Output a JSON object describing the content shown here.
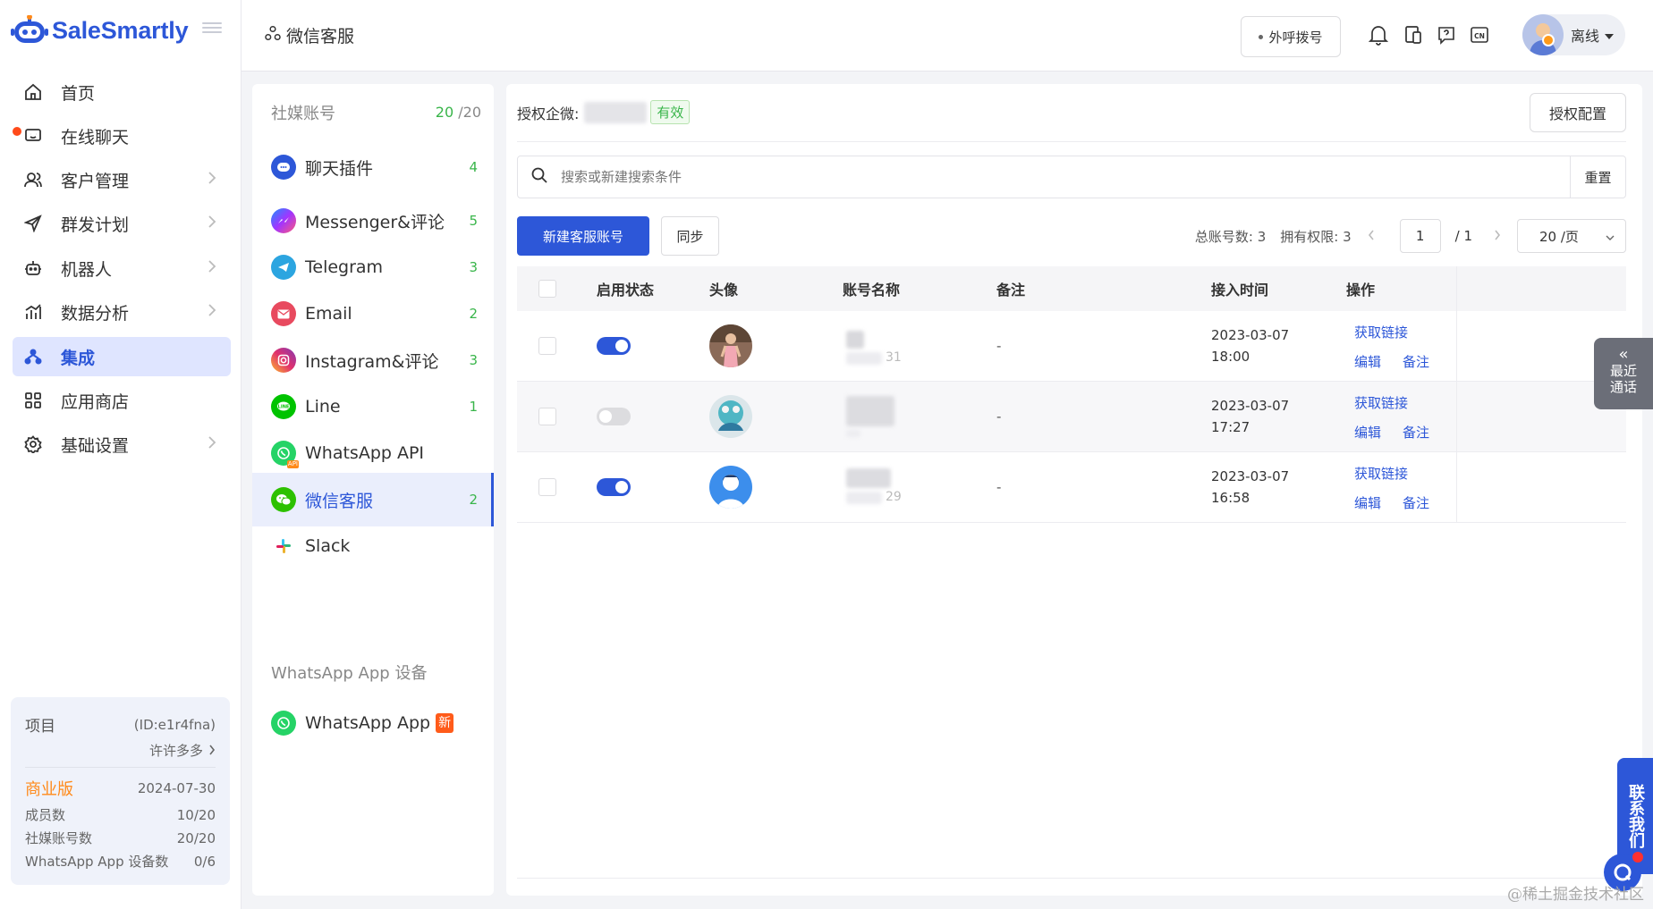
{
  "app": {
    "logo_text": "SaleSmartly",
    "brand_color": "#2d57d8"
  },
  "sidebar": {
    "items": [
      {
        "label": "首页",
        "icon": "home-icon"
      },
      {
        "label": "在线聊天",
        "icon": "chat-icon"
      },
      {
        "label": "客户管理",
        "icon": "customers-icon"
      },
      {
        "label": "群发计划",
        "icon": "send-icon"
      },
      {
        "label": "机器人",
        "icon": "robot-icon"
      },
      {
        "label": "数据分析",
        "icon": "analytics-icon"
      },
      {
        "label": "集成",
        "icon": "integration-icon",
        "active": true
      },
      {
        "label": "应用商店",
        "icon": "apps-icon"
      },
      {
        "label": "基础设置",
        "icon": "settings-icon"
      }
    ],
    "project": {
      "title": "项目",
      "id": "(ID:e1r4fna)",
      "name": "许许多多",
      "plan": "商业版",
      "expiry": "2024-07-30",
      "members_label": "成员数",
      "members_value": "10/20",
      "social_label": "社媒账号数",
      "social_value": "20/20",
      "wa_label": "WhatsApp App 设备数",
      "wa_value": "0/6"
    }
  },
  "header": {
    "breadcrumb": "微信客服",
    "call_button": "外呼拨号",
    "user_status": "离线"
  },
  "channels": {
    "heading": "社媒账号",
    "count_used": "20",
    "count_total": " /20",
    "items": [
      {
        "label": "聊天插件",
        "count": "4",
        "icon": "chat-plugin-icon",
        "color": "#2d57d8"
      },
      {
        "label": "Messenger&评论",
        "count": "5",
        "icon": "messenger-icon",
        "color": "#8a4dff"
      },
      {
        "label": "Telegram",
        "count": "3",
        "icon": "telegram-icon",
        "color": "#2ca5e0"
      },
      {
        "label": "Email",
        "count": "2",
        "icon": "email-icon",
        "color": "#e84a5f"
      },
      {
        "label": "Instagram&评论",
        "count": "3",
        "icon": "instagram-icon",
        "color": "#d6249f"
      },
      {
        "label": "Line",
        "count": "1",
        "icon": "line-icon",
        "color": "#00c300"
      },
      {
        "label": "WhatsApp API",
        "count": "",
        "icon": "whatsapp-api-icon",
        "color": "#25d366"
      },
      {
        "label": "微信客服",
        "count": "2",
        "icon": "wechat-icon",
        "color": "#2dc100",
        "active": true
      },
      {
        "label": "Slack",
        "count": "",
        "icon": "slack-icon",
        "color": "#e01e5a"
      }
    ],
    "device_heading": "WhatsApp App 设备",
    "device_item": "WhatsApp App",
    "new_tag": "新"
  },
  "main": {
    "auth_label": "授权企微:",
    "auth_status": "有效",
    "auth_config": "授权配置",
    "search_placeholder": "搜索或新建搜索条件",
    "reset": "重置",
    "new_button": "新建客服账号",
    "sync_button": "同步",
    "total_label": "总账号数: 3",
    "perm_label": "拥有权限: 3",
    "page_current": "1",
    "page_total": "/ 1",
    "page_size": "20 /页",
    "columns": [
      "启用状态",
      "头像",
      "账号名称",
      "备注",
      "接入时间",
      "操作"
    ],
    "rows": [
      {
        "enabled": true,
        "name_suffix": "31",
        "note": "-",
        "date": "2023-03-07",
        "time": "18:00",
        "op_link": "获取链接",
        "op_edit": "编辑",
        "op_note": "备注"
      },
      {
        "enabled": false,
        "name_suffix": "",
        "note": "-",
        "date": "2023-03-07",
        "time": "17:27",
        "op_link": "获取链接",
        "op_edit": "编辑",
        "op_note": "备注"
      },
      {
        "enabled": true,
        "name_suffix": "29",
        "note": "-",
        "date": "2023-03-07",
        "time": "16:58",
        "op_link": "获取链接",
        "op_edit": "编辑",
        "op_note": "备注"
      }
    ]
  },
  "floaters": {
    "recent_arrow": "«",
    "recent_label1": "最近",
    "recent_label2": "通话",
    "contact_us": "联系我们",
    "watermark": "@稀土掘金技术社区"
  }
}
